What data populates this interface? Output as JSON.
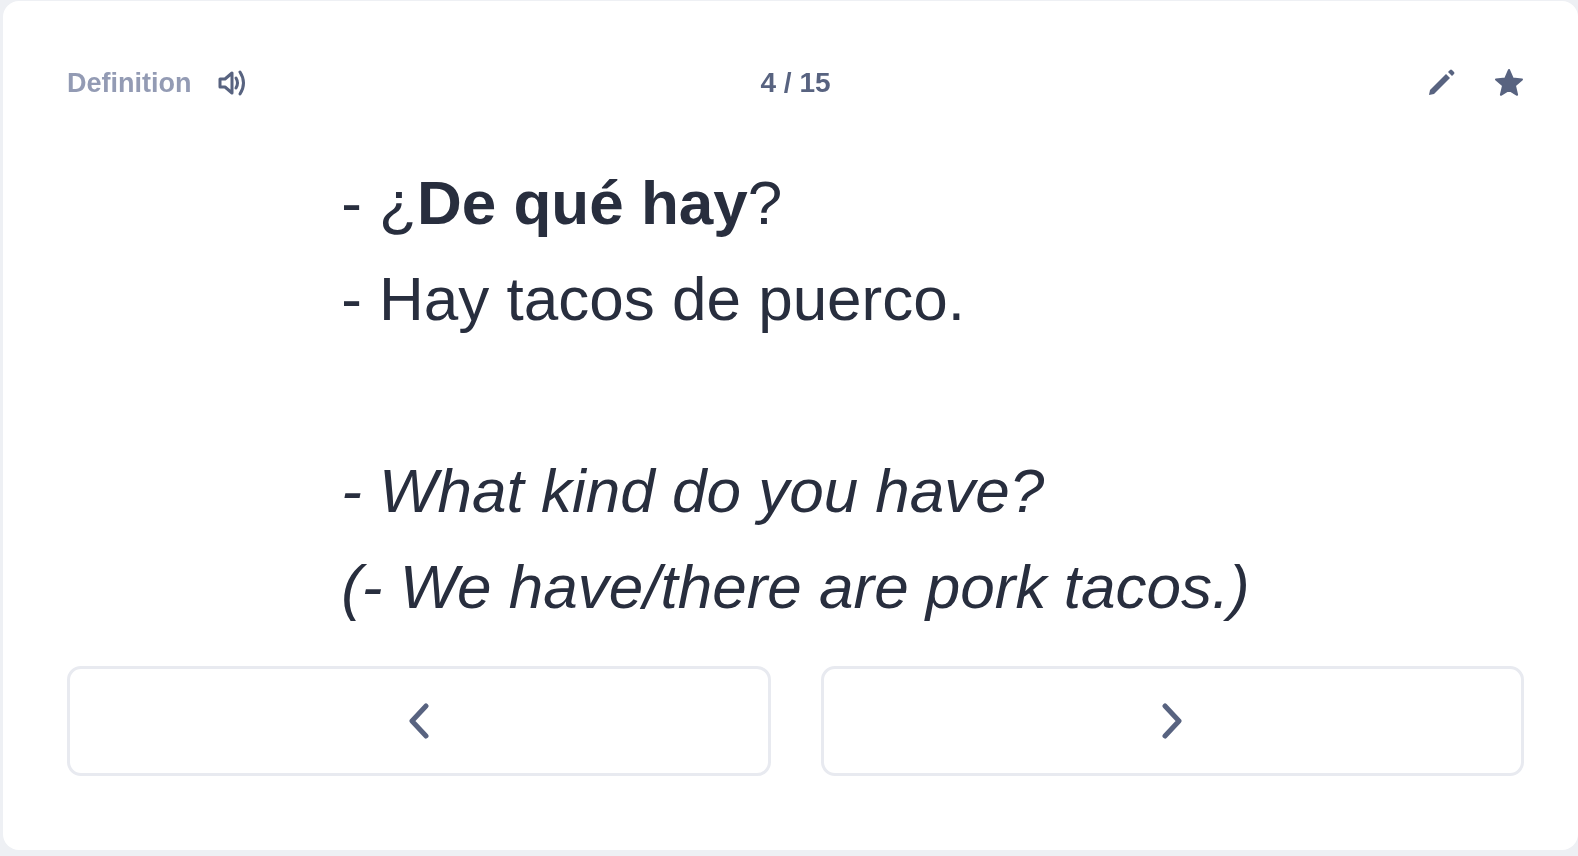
{
  "card": {
    "side_label": "Definition",
    "counter": "4 / 15",
    "starred": true,
    "term_lines": [
      "- ¿**De qué hay**?",
      "- Hay tacos de puerco."
    ],
    "translation_lines": [
      "- What kind do you have?",
      "(- We have/there are pork tacos.)"
    ]
  },
  "nav_buttons": [
    {
      "kind": "previous"
    },
    {
      "kind": "next"
    }
  ]
}
